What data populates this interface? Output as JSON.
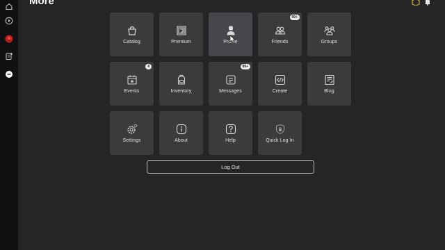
{
  "page": {
    "title": "More"
  },
  "tiles": [
    {
      "label": "Catalog"
    },
    {
      "label": "Premium"
    },
    {
      "label": "Profile"
    },
    {
      "label": "Friends",
      "badge": "99+"
    },
    {
      "label": "Groups"
    },
    {
      "label": "Events",
      "badge": "4"
    },
    {
      "label": "Inventory"
    },
    {
      "label": "Messages",
      "badge": "99+"
    },
    {
      "label": "Create"
    },
    {
      "label": "Blog"
    },
    {
      "label": "Settings"
    },
    {
      "label": "About"
    },
    {
      "label": "Help"
    },
    {
      "label": "Quick Log In"
    }
  ],
  "logout": {
    "label": "Log Out"
  },
  "colors": {
    "background": "#232527",
    "rail": "#101113",
    "tile": "#393b3d",
    "tile_hover": "#45474a",
    "avatar_red": "#c0201a"
  }
}
